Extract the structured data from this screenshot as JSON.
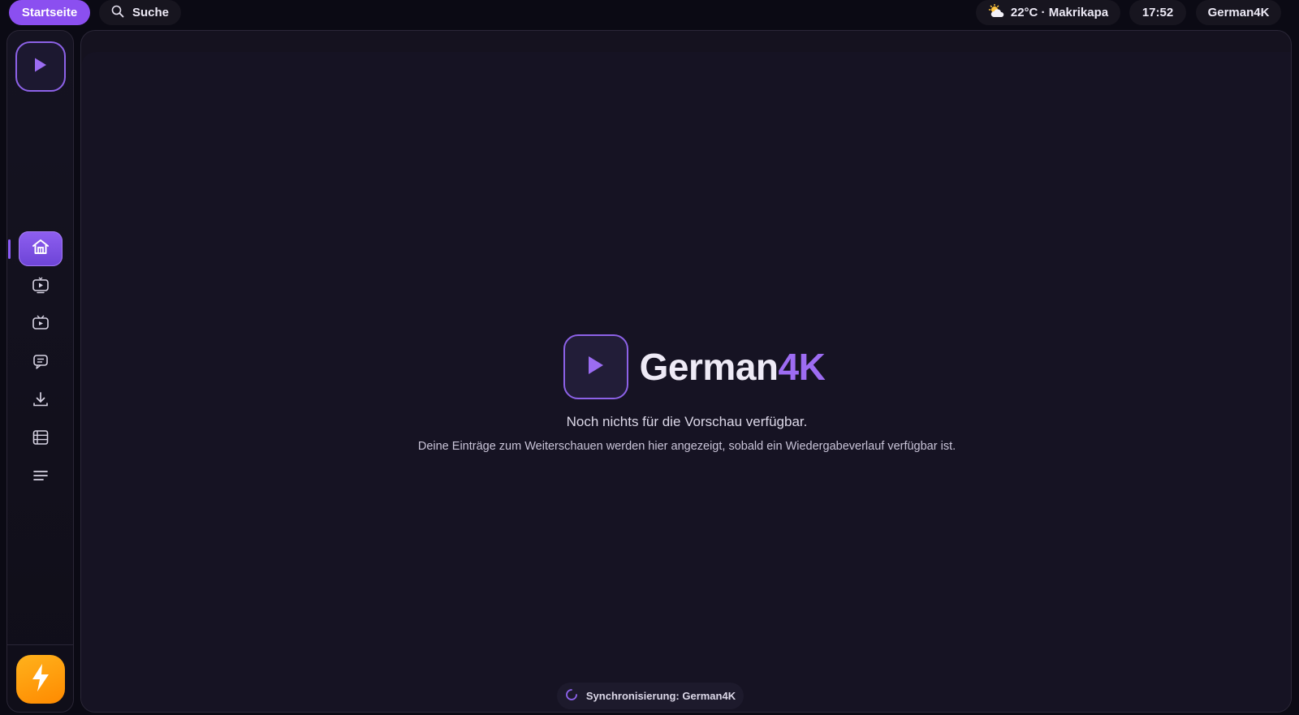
{
  "topbar": {
    "home_label": "Startseite",
    "search_label": "Suche",
    "weather": "22°C · Makrikapa",
    "time": "17:52",
    "profile": "German4K",
    "accent_color": "#8b4ff0"
  },
  "sidebar": {
    "logo_icon": "play-icon",
    "items": [
      {
        "name": "home",
        "icon": "home-icon",
        "active": true
      },
      {
        "name": "live-tv",
        "icon": "tv-play-icon",
        "active": false
      },
      {
        "name": "series",
        "icon": "tv-box-icon",
        "active": false
      },
      {
        "name": "messages",
        "icon": "chat-icon",
        "active": false
      },
      {
        "name": "downloads",
        "icon": "download-icon",
        "active": false
      },
      {
        "name": "playlists",
        "icon": "list-grid-icon",
        "active": false
      },
      {
        "name": "menu",
        "icon": "menu-icon",
        "active": false
      }
    ],
    "power_icon": "bolt-icon"
  },
  "main": {
    "brand_name": "German",
    "brand_accent": "4K",
    "empty_title": "Noch nichts für die Vorschau verfügbar.",
    "empty_subtitle": "Deine Einträge zum Weiterschauen werden hier angezeigt, sobald ein Wiedergabeverlauf verfügbar ist.",
    "sync_status": "Synchronisierung: German4K"
  }
}
